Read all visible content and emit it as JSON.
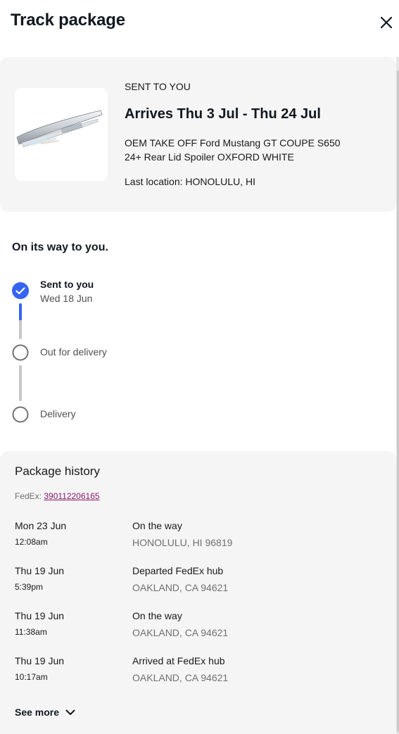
{
  "header": {
    "title": "Track package"
  },
  "item": {
    "sent_label": "SENT TO YOU",
    "arrival": "Arrives Thu 3 Jul - Thu 24 Jul",
    "title": "OEM TAKE OFF Ford Mustang GT COUPE S650 24+ Rear Lid Spoiler OXFORD WHITE",
    "last_location": "Last location: HONOLULU, HI"
  },
  "progress": {
    "title": "On its way to you.",
    "steps": [
      {
        "label": "Sent to you",
        "date": "Wed 18 Jun",
        "done": true
      },
      {
        "label": "Out for delivery",
        "done": false
      },
      {
        "label": "Delivery",
        "done": false
      }
    ]
  },
  "history": {
    "title": "Package history",
    "carrier_prefix": "FedEx:",
    "tracking_number": "390112206165",
    "events": [
      {
        "date": "Mon 23 Jun",
        "time": "12:08am",
        "status": "On the way",
        "location": "HONOLULU, HI 96819"
      },
      {
        "date": "Thu 19 Jun",
        "time": "5:39pm",
        "status": "Departed FedEx hub",
        "location": "OAKLAND, CA 94621"
      },
      {
        "date": "Thu 19 Jun",
        "time": "11:38am",
        "status": "On the way",
        "location": "OAKLAND, CA 94621"
      },
      {
        "date": "Thu 19 Jun",
        "time": "10:17am",
        "status": "Arrived at FedEx hub",
        "location": "OAKLAND, CA 94621"
      }
    ],
    "see_more": "See more"
  },
  "colors": {
    "accent": "#3665f3",
    "link": "#8b1a6b",
    "card_bg": "#f5f5f5",
    "muted_text": "#707070"
  }
}
